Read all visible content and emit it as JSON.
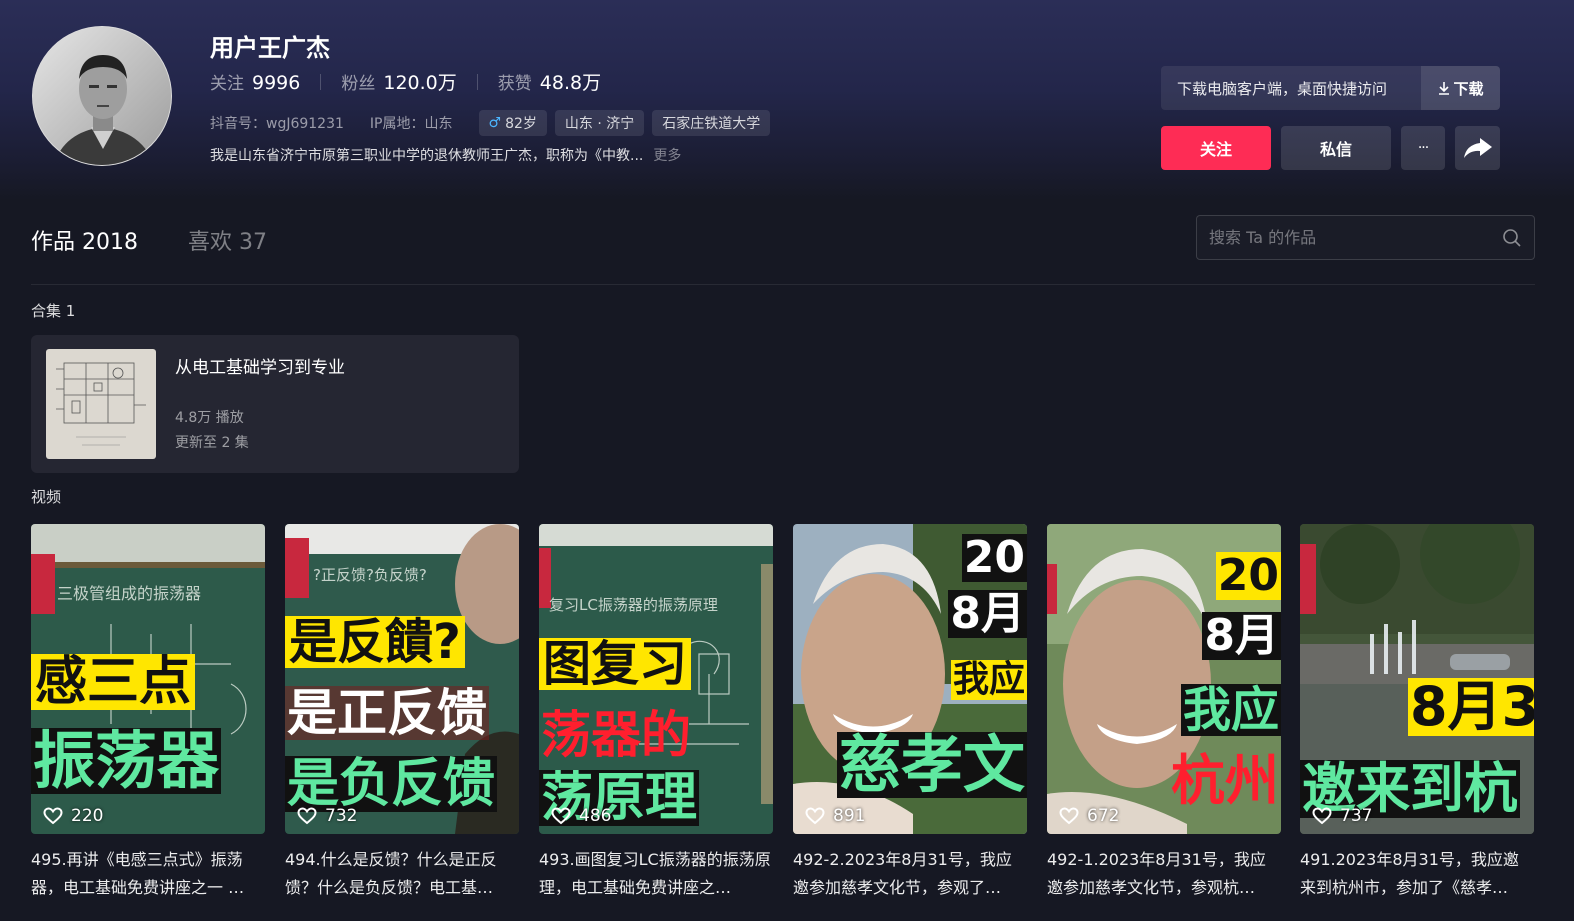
{
  "profile": {
    "name": "用户王广杰",
    "stats": [
      {
        "label": "关注",
        "value": "9996"
      },
      {
        "label": "粉丝",
        "value": "120.0万"
      },
      {
        "label": "获赞",
        "value": "48.8万"
      }
    ],
    "douyin_id": "抖音号：wgJ691231",
    "ip": "IP属地：山东",
    "tags": {
      "age": "82岁",
      "region": "山东 · 济宁",
      "school": "石家庄铁道大学"
    },
    "bio": "我是山东省济宁市原第三职业中学的退休教师王广杰，职称为《中教...",
    "bio_more": "更多"
  },
  "actions": {
    "download_text": "下载电脑客户端，桌面快捷访问",
    "download_btn": "下载",
    "follow": "关注",
    "message": "私信",
    "more": "···"
  },
  "tabs": [
    {
      "label": "作品",
      "count": "2018"
    },
    {
      "label": "喜欢",
      "count": "37"
    }
  ],
  "search": {
    "placeholder": "搜索 Ta 的作品"
  },
  "collection_section": {
    "label": "合集 1"
  },
  "collection": {
    "title": "从电工基础学习到专业",
    "plays": "4.8万 播放",
    "update": "更新至 2 集"
  },
  "videos_section": {
    "label": "视频"
  },
  "videos": [
    {
      "likes": "220",
      "title": "495.再讲《电感三点式》振荡器，电工基础免费讲座之一 …",
      "overlay": [
        "感三点",
        "振荡器"
      ],
      "chalk": "三极管组成的振荡器"
    },
    {
      "likes": "732",
      "title": "494.什么是反馈？什么是正反馈？什么是负反馈？电工基…",
      "overlay": [
        "是反饋?",
        "是正反馈",
        "是负反馈"
      ],
      "chalk": "?正反馈?负反馈?"
    },
    {
      "likes": "486",
      "title": "493.画图复习LC振荡器的振荡原理，电工基础免费讲座之…",
      "overlay": [
        "图复习",
        "荡器的",
        "荡原理"
      ],
      "chalk": "复习LC振荡器的振荡原理"
    },
    {
      "likes": "891",
      "title": "492-2.2023年8月31号，我应邀参加慈孝文化节，参观了…",
      "overlay": [
        "20",
        "8月",
        "我应",
        "慈孝文"
      ]
    },
    {
      "likes": "672",
      "title": "492-1.2023年8月31号，我应邀参加慈孝文化节，参观杭…",
      "overlay": [
        "20",
        "8月",
        "我应",
        "杭州"
      ]
    },
    {
      "likes": "737",
      "title": "491.2023年8月31号，我应邀来到杭州市，参加了《慈孝…",
      "overlay": [
        "8月3",
        "邀来到杭"
      ]
    }
  ],
  "colors": {
    "accent": "#fe2c55",
    "background": "#161823",
    "overlay_yellow": "#ffe600",
    "overlay_green": "#5fe8a0",
    "overlay_red": "#ff1f2e"
  }
}
